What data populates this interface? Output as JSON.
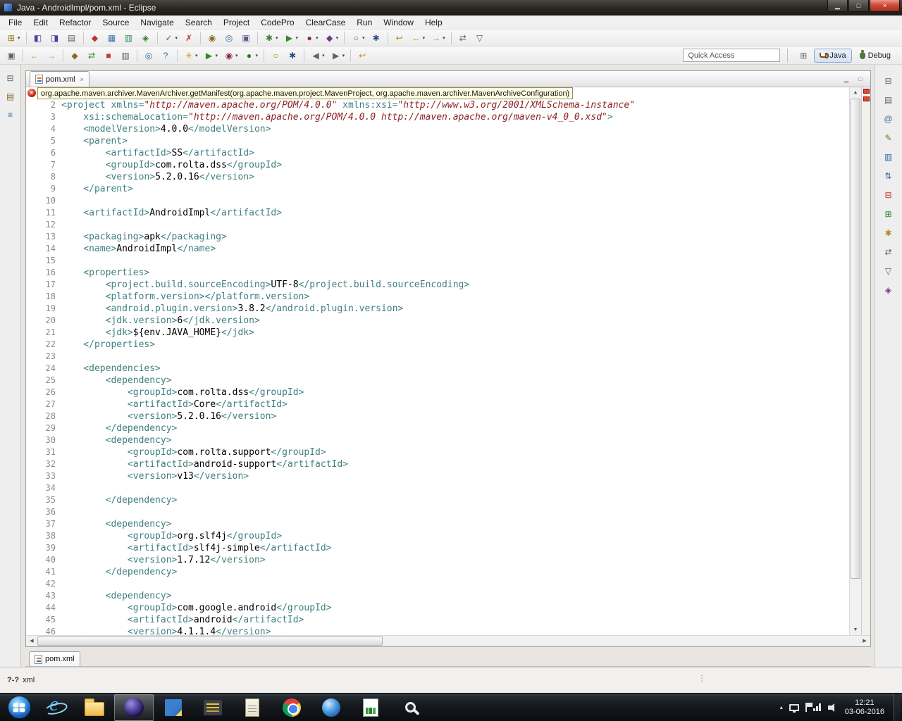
{
  "window": {
    "title": "Java - AndroidImpl/pom.xml - Eclipse",
    "controls": [
      {
        "n": "minimize-button",
        "g": "▁"
      },
      {
        "n": "maximize-button",
        "g": "□"
      },
      {
        "n": "close-button",
        "g": "×",
        "close": true
      }
    ]
  },
  "menu": [
    "File",
    "Edit",
    "Refactor",
    "Source",
    "Navigate",
    "Search",
    "Project",
    "CodePro",
    "ClearCase",
    "Run",
    "Window",
    "Help"
  ],
  "toolbar_row1": [
    {
      "n": "new-button",
      "g": "⊞",
      "c": "#97790f",
      "d": 1
    },
    {
      "sep": 1
    },
    {
      "n": "save-button",
      "g": "◧",
      "c": "#4a3f9f"
    },
    {
      "n": "save-all-button",
      "g": "◨",
      "c": "#4a3f9f"
    },
    {
      "n": "print-button",
      "g": "▤",
      "c": "#5a6570"
    },
    {
      "sep": 1
    },
    {
      "n": "codepro-audit-button",
      "g": "◆",
      "c": "#b23a2a"
    },
    {
      "n": "codepro-metrics-button",
      "g": "▦",
      "c": "#3a70b0"
    },
    {
      "n": "codepro-dashboard-button",
      "g": "▥",
      "c": "#2f8a6a"
    },
    {
      "n": "junit-test-button",
      "g": "◈",
      "c": "#2f7a2f"
    },
    {
      "sep": 1
    },
    {
      "n": "task-check-button",
      "g": "✓",
      "c": "#2f8a2f",
      "d": 1
    },
    {
      "n": "delete-item-button",
      "g": "✗",
      "c": "#b23a2a"
    },
    {
      "sep": 1
    },
    {
      "n": "clearcase-checkin-button",
      "g": "◉",
      "c": "#8a6a1f"
    },
    {
      "n": "clearcase-checkout-button",
      "g": "◎",
      "c": "#2f6a9a"
    },
    {
      "n": "clearcase-update-button",
      "g": "▣",
      "c": "#5a5a8a"
    },
    {
      "sep": 1
    },
    {
      "n": "debug-launch-button",
      "g": "✱",
      "c": "#3a7a3a",
      "d": 1
    },
    {
      "n": "run-launch-button",
      "g": "▶",
      "c": "#2e8b2e",
      "d": 1
    },
    {
      "n": "profile-launch-button",
      "g": "●",
      "c": "#8a2a3a",
      "d": 1
    },
    {
      "n": "external-tools-button",
      "g": "◆",
      "c": "#6a3a8a",
      "d": 1
    },
    {
      "sep": 1
    },
    {
      "n": "new-java-class-button",
      "g": "○",
      "c": "#3a6a9a",
      "d": 1
    },
    {
      "n": "open-search-button",
      "g": "✱",
      "c": "#2a4a8a"
    },
    {
      "sep": 1
    },
    {
      "n": "last-edit-location-button",
      "g": "↩",
      "c": "#b8860b"
    },
    {
      "n": "back-history-button",
      "g": "←",
      "c": "#b8860b",
      "d": 1
    },
    {
      "n": "forward-history-button",
      "g": "→",
      "c": "#b8860b",
      "d": 1
    },
    {
      "sep": 1
    },
    {
      "n": "link-with-editor-button",
      "g": "⇄",
      "c": "#5a6570"
    },
    {
      "n": "pin-editor-button",
      "g": "▽",
      "c": "#5a6570"
    }
  ],
  "toolbar_row2": [
    {
      "n": "restore-view-button",
      "g": "▣",
      "c": "#5a6570"
    },
    {
      "sep": 1
    },
    {
      "n": "back-button",
      "g": "←",
      "c": "#c09020"
    },
    {
      "n": "forward-button",
      "g": "→",
      "c": "#c09020"
    },
    {
      "sep": 1
    },
    {
      "n": "ant-build-button",
      "g": "◆",
      "c": "#8a6a2a"
    },
    {
      "n": "refresh-button",
      "g": "⇄",
      "c": "#2f8a2f"
    },
    {
      "n": "terminate-button",
      "g": "■",
      "c": "#c03a2a"
    },
    {
      "n": "console-button",
      "g": "▥",
      "c": "#5a6570"
    },
    {
      "sep": 1
    },
    {
      "n": "magnify-button",
      "g": "◎",
      "c": "#2f6a9a"
    },
    {
      "n": "help-button",
      "g": "?",
      "c": "#2f6a9a"
    },
    {
      "sep": 1
    },
    {
      "n": "quick-fix-button",
      "g": "✳",
      "c": "#c0a020",
      "d": 1
    },
    {
      "n": "run-last-button",
      "g": "▶",
      "c": "#2e8b2e",
      "d": 1
    },
    {
      "n": "coverage-last-button",
      "g": "◉",
      "c": "#8a2a3a",
      "d": 1
    },
    {
      "n": "external-tools-run-button",
      "g": "●",
      "c": "#2f7a2f",
      "d": 1
    },
    {
      "sep": 1
    },
    {
      "n": "open-type-button",
      "g": "○",
      "c": "#97790f"
    },
    {
      "n": "file-search-button",
      "g": "✱",
      "c": "#2a4a8a"
    },
    {
      "sep": 1
    },
    {
      "n": "previous-annotation-button",
      "g": "◀",
      "c": "#5a6570",
      "d": 1
    },
    {
      "n": "next-annotation-button",
      "g": "▶",
      "c": "#5a6570",
      "d": 1
    },
    {
      "sep": 1
    },
    {
      "n": "last-location-button",
      "g": "↩",
      "c": "#c09020"
    }
  ],
  "quick_access": {
    "placeholder": "Quick Access"
  },
  "perspectives": {
    "open_icon": "⊞",
    "java": "Java",
    "debug": "Debug"
  },
  "left_strip": [
    {
      "n": "restore-left-views-button",
      "g": "⊟",
      "c": "#5a6570"
    },
    {
      "n": "package-explorer-button",
      "g": "▤",
      "c": "#8a6a2a"
    },
    {
      "n": "type-hierarchy-button",
      "g": "≡",
      "c": "#3a6a9a"
    }
  ],
  "right_strip": [
    {
      "n": "restore-right-views-button",
      "g": "⊟",
      "c": "#5a6570"
    },
    {
      "n": "outline-design-button",
      "g": "▤",
      "c": "#5a6570"
    },
    {
      "n": "show-annotations-button",
      "g": "@",
      "c": "#3a6a9a"
    },
    {
      "n": "edit-styles-button",
      "g": "✎",
      "c": "#8a6a2a"
    },
    {
      "n": "preview-button",
      "g": "▥",
      "c": "#2f6a9a"
    },
    {
      "n": "sort-button",
      "g": "⇅",
      "c": "#3a6a9a"
    },
    {
      "n": "collapse-all-button",
      "g": "⊟",
      "c": "#b23a2a"
    },
    {
      "n": "expand-all-button",
      "g": "⊞",
      "c": "#2f8a2f"
    },
    {
      "n": "favorites-button",
      "g": "✱",
      "c": "#b08a20"
    },
    {
      "n": "link-outline-button",
      "g": "⇄",
      "c": "#5a6570"
    },
    {
      "n": "filter-button",
      "g": "▽",
      "c": "#5a6570"
    },
    {
      "n": "attributes-button",
      "g": "◈",
      "c": "#6a3a8a"
    }
  ],
  "editor": {
    "tab_label": "pom.xml",
    "window_buttons": [
      {
        "n": "minimize-editor-button",
        "g": "▁"
      },
      {
        "n": "maximize-editor-button",
        "g": "□"
      }
    ],
    "tooltip": "org.apache.maven.archiver.MavenArchiver.getManifest(org.apache.maven.project.MavenProject, org.apache.maven.archiver.MavenArchiveConfiguration)",
    "syntax_colors": {
      "tag": "#3f7f7f",
      "attr": "#3f7f7f",
      "value": "#8b1f1f",
      "text": "#000000"
    },
    "lines": [
      [],
      [
        [
          "t",
          "<project"
        ],
        [
          "a",
          " xmlns="
        ],
        [
          "v",
          "\"http://maven.apache.org/POM/4.0.0\""
        ],
        [
          "a",
          " xmlns:xsi="
        ],
        [
          "v",
          "\"http://www.w3.org/2001/XMLSchema-instance\""
        ]
      ],
      [
        [
          "a",
          "    xsi:schemaLocation="
        ],
        [
          "v",
          "\"http://maven.apache.org/POM/4.0.0 http://maven.apache.org/maven-v4_0_0.xsd\""
        ],
        [
          "t",
          ">"
        ]
      ],
      [
        [
          "t",
          "    <modelVersion>"
        ],
        [
          "x",
          "4.0.0"
        ],
        [
          "t",
          "</modelVersion>"
        ]
      ],
      [
        [
          "t",
          "    <parent>"
        ]
      ],
      [
        [
          "t",
          "        <artifactId>"
        ],
        [
          "x",
          "SS"
        ],
        [
          "t",
          "</artifactId>"
        ]
      ],
      [
        [
          "t",
          "        <groupId>"
        ],
        [
          "x",
          "com.rolta.dss"
        ],
        [
          "t",
          "</groupId>"
        ]
      ],
      [
        [
          "t",
          "        <version>"
        ],
        [
          "x",
          "5.2.0.16"
        ],
        [
          "t",
          "</version>"
        ]
      ],
      [
        [
          "t",
          "    </parent>"
        ]
      ],
      [],
      [
        [
          "t",
          "    <artifactId>"
        ],
        [
          "x",
          "AndroidImpl"
        ],
        [
          "t",
          "</artifactId>"
        ]
      ],
      [],
      [
        [
          "t",
          "    <packaging>"
        ],
        [
          "x",
          "apk"
        ],
        [
          "t",
          "</packaging>"
        ]
      ],
      [
        [
          "t",
          "    <name>"
        ],
        [
          "x",
          "AndroidImpl"
        ],
        [
          "t",
          "</name>"
        ]
      ],
      [],
      [
        [
          "t",
          "    <properties>"
        ]
      ],
      [
        [
          "t",
          "        <project.build.sourceEncoding>"
        ],
        [
          "x",
          "UTF-8"
        ],
        [
          "t",
          "</project.build.sourceEncoding>"
        ]
      ],
      [
        [
          "t",
          "        <platform.version></platform.version>"
        ]
      ],
      [
        [
          "t",
          "        <android.plugin.version>"
        ],
        [
          "x",
          "3.8.2"
        ],
        [
          "t",
          "</android.plugin.version>"
        ]
      ],
      [
        [
          "t",
          "        <jdk.version>"
        ],
        [
          "x",
          "6"
        ],
        [
          "t",
          "</jdk.version>"
        ]
      ],
      [
        [
          "t",
          "        <jdk>"
        ],
        [
          "x",
          "${env.JAVA_HOME}"
        ],
        [
          "t",
          "</jdk>"
        ]
      ],
      [
        [
          "t",
          "    </properties>"
        ]
      ],
      [],
      [
        [
          "t",
          "    <dependencies>"
        ]
      ],
      [
        [
          "t",
          "        <dependency>"
        ]
      ],
      [
        [
          "t",
          "            <groupId>"
        ],
        [
          "x",
          "com.rolta.dss"
        ],
        [
          "t",
          "</groupId>"
        ]
      ],
      [
        [
          "t",
          "            <artifactId>"
        ],
        [
          "x",
          "Core"
        ],
        [
          "t",
          "</artifactId>"
        ]
      ],
      [
        [
          "t",
          "            <version>"
        ],
        [
          "x",
          "5.2.0.16"
        ],
        [
          "t",
          "</version>"
        ]
      ],
      [
        [
          "t",
          "        </dependency>"
        ]
      ],
      [
        [
          "t",
          "        <dependency>"
        ]
      ],
      [
        [
          "t",
          "            <groupId>"
        ],
        [
          "x",
          "com.rolta.support"
        ],
        [
          "t",
          "</groupId>"
        ]
      ],
      [
        [
          "t",
          "            <artifactId>"
        ],
        [
          "x",
          "android-support"
        ],
        [
          "t",
          "</artifactId>"
        ]
      ],
      [
        [
          "t",
          "            <version>"
        ],
        [
          "x",
          "v13"
        ],
        [
          "t",
          "</version>"
        ]
      ],
      [],
      [
        [
          "t",
          "        </dependency>"
        ]
      ],
      [],
      [
        [
          "t",
          "        <dependency>"
        ]
      ],
      [
        [
          "t",
          "            <groupId>"
        ],
        [
          "x",
          "org.slf4j"
        ],
        [
          "t",
          "</groupId>"
        ]
      ],
      [
        [
          "t",
          "            <artifactId>"
        ],
        [
          "x",
          "slf4j-simple"
        ],
        [
          "t",
          "</artifactId>"
        ]
      ],
      [
        [
          "t",
          "            <version>"
        ],
        [
          "x",
          "1.7.12"
        ],
        [
          "t",
          "</version>"
        ]
      ],
      [
        [
          "t",
          "        </dependency>"
        ]
      ],
      [],
      [
        [
          "t",
          "        <dependency>"
        ]
      ],
      [
        [
          "t",
          "            <groupId>"
        ],
        [
          "x",
          "com.google.android"
        ],
        [
          "t",
          "</groupId>"
        ]
      ],
      [
        [
          "t",
          "            <artifactId>"
        ],
        [
          "x",
          "android"
        ],
        [
          "t",
          "</artifactId>"
        ]
      ],
      [
        [
          "t",
          "            <version>"
        ],
        [
          "x",
          "4.1.1.4"
        ],
        [
          "t",
          "</version>"
        ]
      ]
    ]
  },
  "bottom_tab_label": "pom.xml",
  "status": {
    "badge": "?-?",
    "label": "xml"
  },
  "icons": {
    "tab_close": "×",
    "scroll_up": "▲",
    "scroll_down": "▼",
    "scroll_left": "◀",
    "scroll_right": "▶",
    "drag_handle": "⋮"
  },
  "taskbar": {
    "items": [
      {
        "n": "start-button",
        "kind": "start"
      },
      {
        "n": "taskbar-ie-button",
        "kind": "ie"
      },
      {
        "n": "taskbar-explorer-button",
        "kind": "folder"
      },
      {
        "n": "taskbar-eclipse-button",
        "kind": "eclipse",
        "active": true
      },
      {
        "n": "taskbar-notes-button",
        "kind": "notes"
      },
      {
        "n": "taskbar-archive-button",
        "kind": "books"
      },
      {
        "n": "taskbar-notepad-button",
        "kind": "notepad"
      },
      {
        "n": "taskbar-chrome-button",
        "kind": "chrome"
      },
      {
        "n": "taskbar-app-button",
        "kind": "sphere"
      },
      {
        "n": "taskbar-chart-button",
        "kind": "chart"
      },
      {
        "n": "taskbar-search-button",
        "kind": "magnifier"
      }
    ],
    "chevron": "▴",
    "tray_icons": [
      {
        "n": "tray-display-icon",
        "kind": "display"
      },
      {
        "n": "tray-flag-icon",
        "kind": "flag"
      },
      {
        "n": "tray-network-icon",
        "kind": "net"
      },
      {
        "n": "tray-volume-icon",
        "kind": "vol"
      }
    ],
    "time": "12:21",
    "date": "03-06-2016"
  }
}
